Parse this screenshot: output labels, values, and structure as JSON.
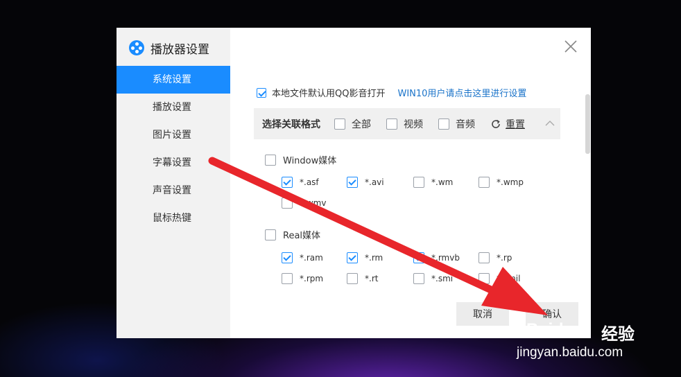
{
  "dialog": {
    "title": "播放器设置",
    "close_icon": "close-icon"
  },
  "sidebar": {
    "items": [
      {
        "label": "系统设置",
        "active": true
      },
      {
        "label": "播放设置",
        "active": false
      },
      {
        "label": "图片设置",
        "active": false
      },
      {
        "label": "字幕设置",
        "active": false
      },
      {
        "label": "声音设置",
        "active": false
      },
      {
        "label": "鼠标热键",
        "active": false
      }
    ]
  },
  "main": {
    "default_open_label": "本地文件默认用QQ影音打开",
    "default_open_checked": true,
    "win10_link": "WIN10用户请点击这里进行设置",
    "filter": {
      "title": "选择关联格式",
      "all": "全部",
      "video": "视频",
      "audio": "音频",
      "reset": "重置"
    },
    "groups": [
      {
        "name": "Window媒体",
        "checked": false,
        "formats": [
          {
            "label": "*.asf",
            "checked": true
          },
          {
            "label": "*.avi",
            "checked": true
          },
          {
            "label": "*.wm",
            "checked": false
          },
          {
            "label": "*.wmp",
            "checked": false
          },
          {
            "label": "*.wmv",
            "checked": false
          }
        ]
      },
      {
        "name": "Real媒体",
        "checked": false,
        "formats": [
          {
            "label": "*.ram",
            "checked": true
          },
          {
            "label": "*.rm",
            "checked": true
          },
          {
            "label": "*.rmvb",
            "checked": true
          },
          {
            "label": "*.rp",
            "checked": false
          },
          {
            "label": "*.rpm",
            "checked": false
          },
          {
            "label": "*.rt",
            "checked": false
          },
          {
            "label": "*.smi",
            "checked": false
          },
          {
            "label": "*.smil",
            "checked": false
          }
        ]
      }
    ]
  },
  "footer": {
    "cancel": "取消",
    "ok": "确认"
  },
  "watermark": {
    "brand": "Baidu",
    "cn": "经验",
    "url": "jingyan.baidu.com"
  },
  "colors": {
    "accent": "#1a8cff",
    "arrow": "#e8262b",
    "link": "#1a73c9"
  }
}
